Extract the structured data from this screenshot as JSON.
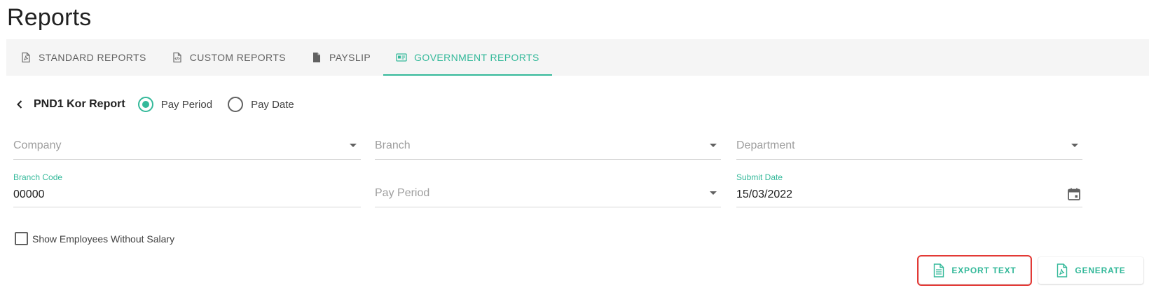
{
  "page": {
    "title": "Reports"
  },
  "tabs": [
    {
      "label": "STANDARD REPORTS",
      "icon": "pdf-file-icon",
      "active": false
    },
    {
      "label": "CUSTOM REPORTS",
      "icon": "code-file-icon",
      "active": false
    },
    {
      "label": "PAYSLIP",
      "icon": "file-icon",
      "active": false
    },
    {
      "label": "GOVERNMENT REPORTS",
      "icon": "id-card-icon",
      "active": true
    }
  ],
  "report": {
    "name": "PND1 Kor Report",
    "period_options": [
      {
        "label": "Pay Period",
        "checked": true
      },
      {
        "label": "Pay Date",
        "checked": false
      }
    ]
  },
  "filters": {
    "company_placeholder": "Company",
    "branch_placeholder": "Branch",
    "department_placeholder": "Department",
    "branch_code_label": "Branch Code",
    "branch_code_value": "00000",
    "pay_period_placeholder": "Pay Period",
    "submit_date_label": "Submit Date",
    "submit_date_value": "15/03/2022"
  },
  "options": {
    "show_without_salary_label": "Show Employees Without Salary",
    "show_without_salary_checked": false
  },
  "actions": {
    "export_label": "EXPORT TEXT",
    "generate_label": "GENERATE"
  },
  "colors": {
    "accent": "#34b99a",
    "highlight": "#e53935",
    "tabbar_bg": "#f5f5f5"
  }
}
